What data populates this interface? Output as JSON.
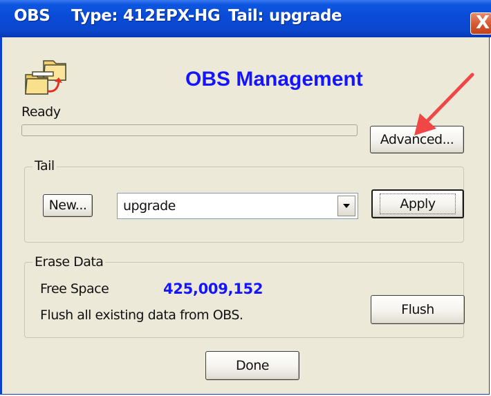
{
  "window": {
    "title_app": "OBS",
    "title_type": "Type: 412EPX-HG",
    "title_tail": "Tail: upgrade",
    "close_glyph": "X"
  },
  "header": {
    "icon": "folders-sync-icon",
    "heading": "OBS Management"
  },
  "status": {
    "text": "Ready",
    "progress": 0
  },
  "advanced_button": "Advanced...",
  "tail_group": {
    "legend": "Tail",
    "new_button": "New...",
    "combo_value": "upgrade",
    "apply_button": "Apply"
  },
  "erase_group": {
    "legend": "Erase Data",
    "free_space_label": "Free Space",
    "free_space_value": "425,009,152",
    "flush_note": "Flush all existing data from OBS.",
    "flush_button": "Flush"
  },
  "done_button": "Done",
  "annotation": {
    "arrow_color": "#f04646",
    "points_to": "advanced-button"
  },
  "colors": {
    "titlebar": "#0a4bd6",
    "heading": "#1414ff",
    "dialog_bg": "#ece9d8"
  }
}
